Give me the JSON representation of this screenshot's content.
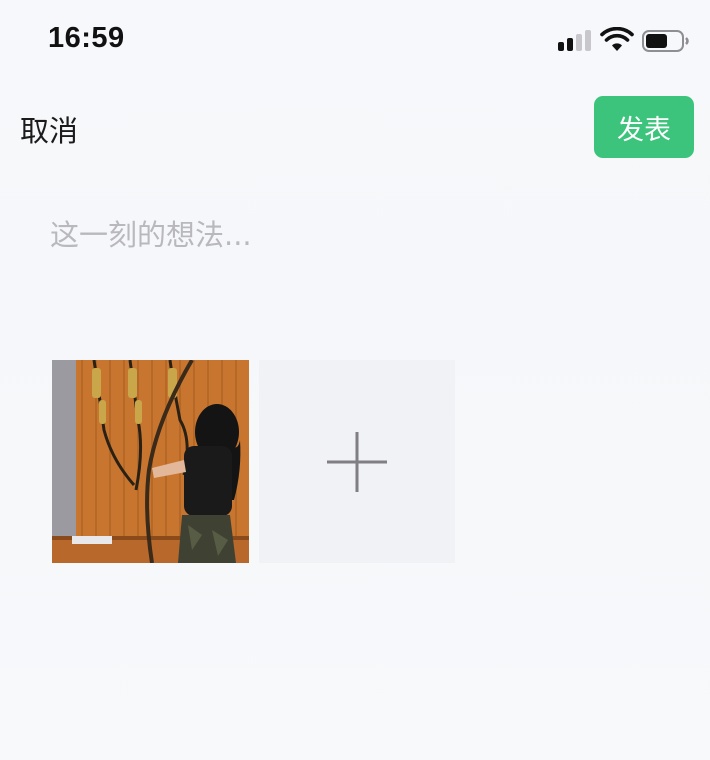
{
  "status": {
    "time": "16:59",
    "signal_icon": "cellular-signal-icon",
    "wifi_icon": "wifi-icon",
    "battery_icon": "battery-icon",
    "battery_level": 0.55
  },
  "nav": {
    "cancel_label": "取消",
    "publish_label": "发表",
    "publish_color": "#3cc47c"
  },
  "composer": {
    "placeholder": "这一刻的想法..."
  },
  "media": {
    "photo_icon": "archery-photo-thumbnail",
    "add_icon": "plus-icon"
  }
}
